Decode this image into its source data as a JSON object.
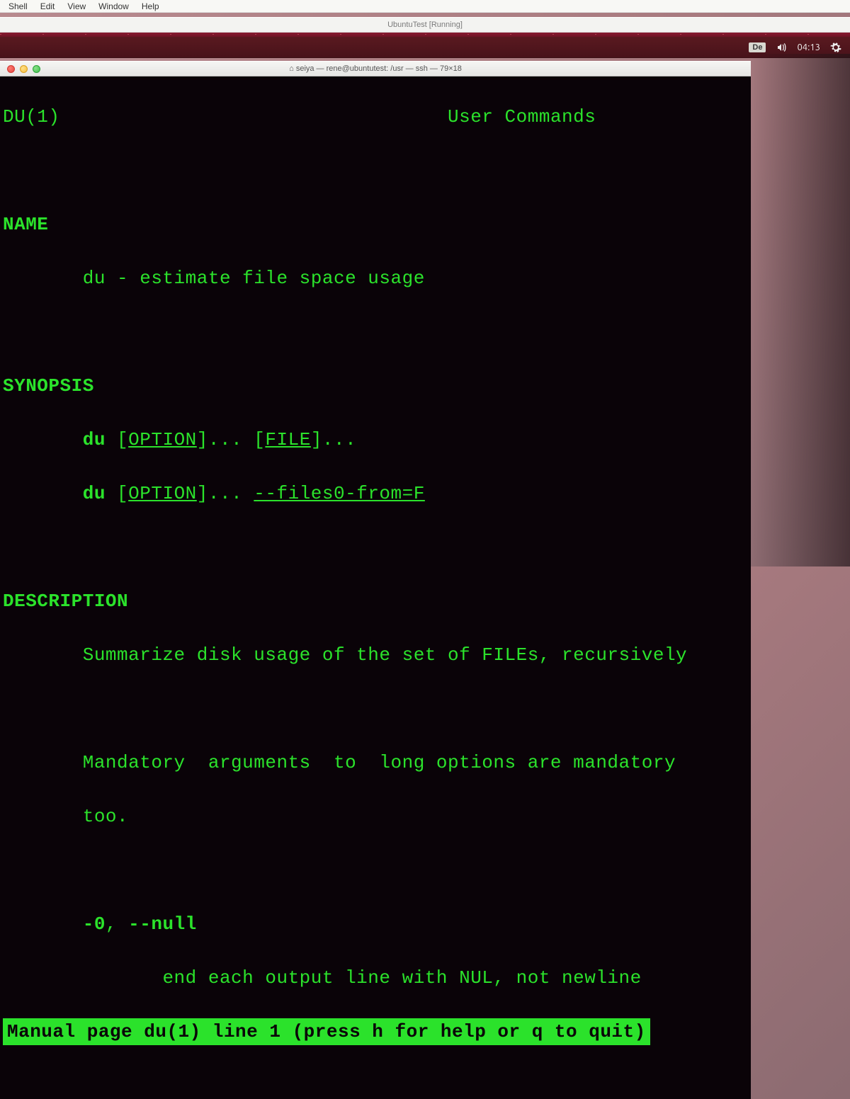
{
  "mac_menu": {
    "items": [
      "Shell",
      "Edit",
      "View",
      "Window",
      "Help"
    ]
  },
  "vm_window": {
    "title": "UbuntuTest [Running]"
  },
  "ubuntu_panel": {
    "keyboard_layout": "De",
    "time": "04:13"
  },
  "terminal": {
    "title": "⌂ seiya — rene@ubuntutest: /usr — ssh — 79×18",
    "man": {
      "header_left": "DU(1)",
      "header_center": "User Commands",
      "section_name": "NAME",
      "name_line": "du - estimate file space usage",
      "section_synopsis": "SYNOPSIS",
      "synopsis_cmd1": "du",
      "synopsis_opt": "OPTION",
      "synopsis_file": "FILE",
      "synopsis_files0": "--files0-from=F",
      "section_description": "DESCRIPTION",
      "desc_line1": "Summarize disk usage of the set of FILEs, recursively",
      "desc_line2a": "Mandatory  arguments  to  long options are mandatory",
      "desc_line2b": "too.",
      "opt_short": "-0",
      "opt_long": "--null",
      "opt_desc": "end each output line with NUL, not newline",
      "status_line": "Manual page du(1) line 1 (press h for help or q to quit)"
    }
  }
}
